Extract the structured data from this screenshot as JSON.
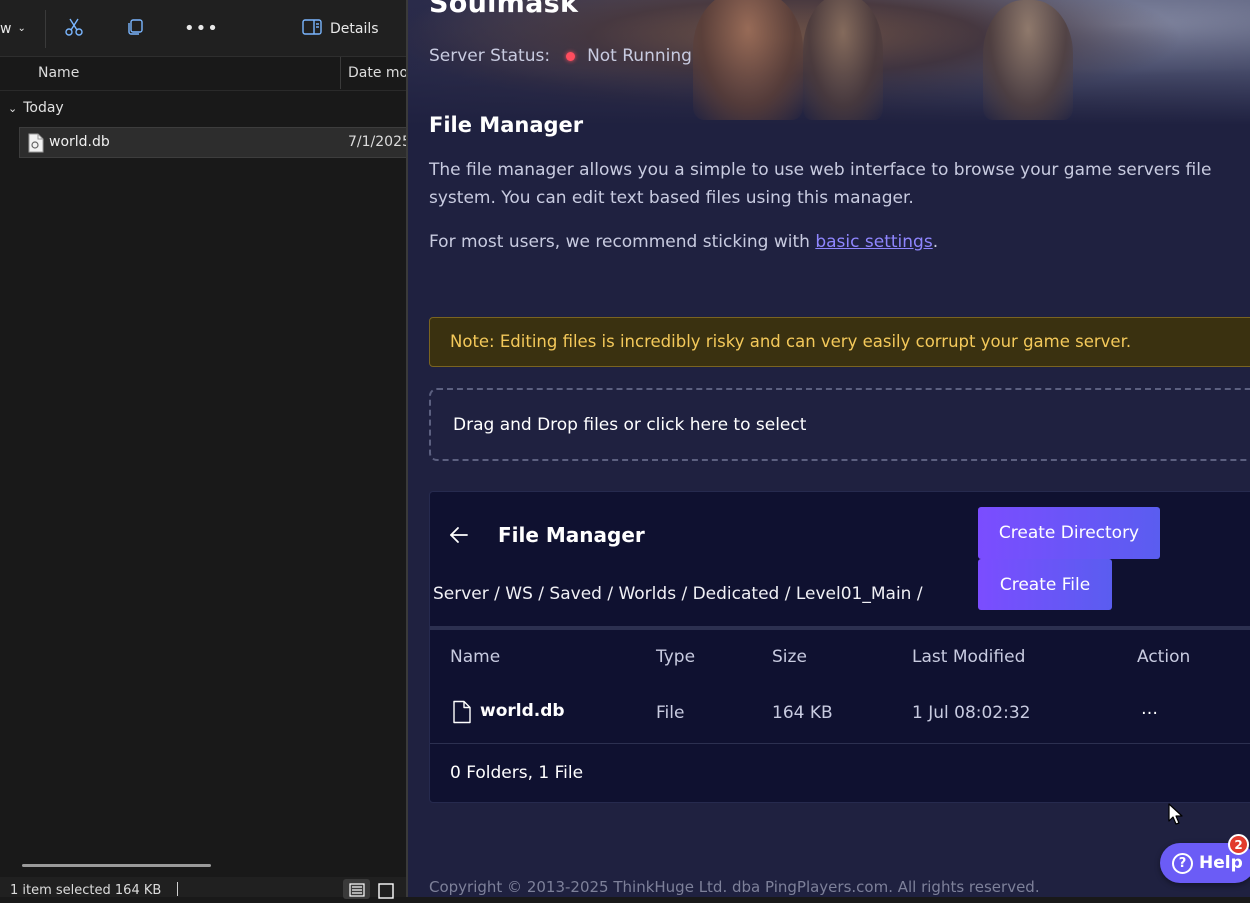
{
  "explorer": {
    "toolbar": {
      "view_label": "w",
      "details_label": "Details"
    },
    "columns": {
      "name": "Name",
      "date": "Date mo"
    },
    "group": "Today",
    "file": {
      "name": "world.db",
      "date": "7/1/2025"
    },
    "status": "1 item selected  164 KB"
  },
  "web": {
    "game_title": "Soulmask",
    "server_status_label": "Server Status:",
    "server_status_value": "Not Running",
    "status_color": "#ff4d5e",
    "fm_heading": "File Manager",
    "fm_description": "The file manager allows you a simple to use web interface to browse your game servers file system. You can edit text based files using this manager.",
    "fm_recommend_prefix": "For most users, we recommend sticking with ",
    "fm_recommend_link": "basic settings",
    "fm_recommend_suffix": ".",
    "note": "Note: Editing files is incredibly risky and can very easily corrupt your game server.",
    "dropzone": "Drag and Drop files or click here to select",
    "card": {
      "title": "File Manager",
      "breadcrumb": "Server / WS / Saved / Worlds / Dedicated / Level01_Main /",
      "create_directory": "Create Directory",
      "create_file": "Create File",
      "columns": {
        "name": "Name",
        "type": "Type",
        "size": "Size",
        "modified": "Last Modified",
        "action": "Action"
      },
      "rows": [
        {
          "name": "world.db",
          "type": "File",
          "size": "164 KB",
          "modified": "1 Jul 08:02:32",
          "action": "…"
        }
      ],
      "summary": "0 Folders, 1 File"
    },
    "copyright": "Copyright © 2013-2025 ThinkHuge Ltd. dba PingPlayers.com. All rights reserved.",
    "help": {
      "label": "Help",
      "badge": "2"
    },
    "accent_color": "#6b5cf6",
    "note_color": "#f4c95a"
  }
}
